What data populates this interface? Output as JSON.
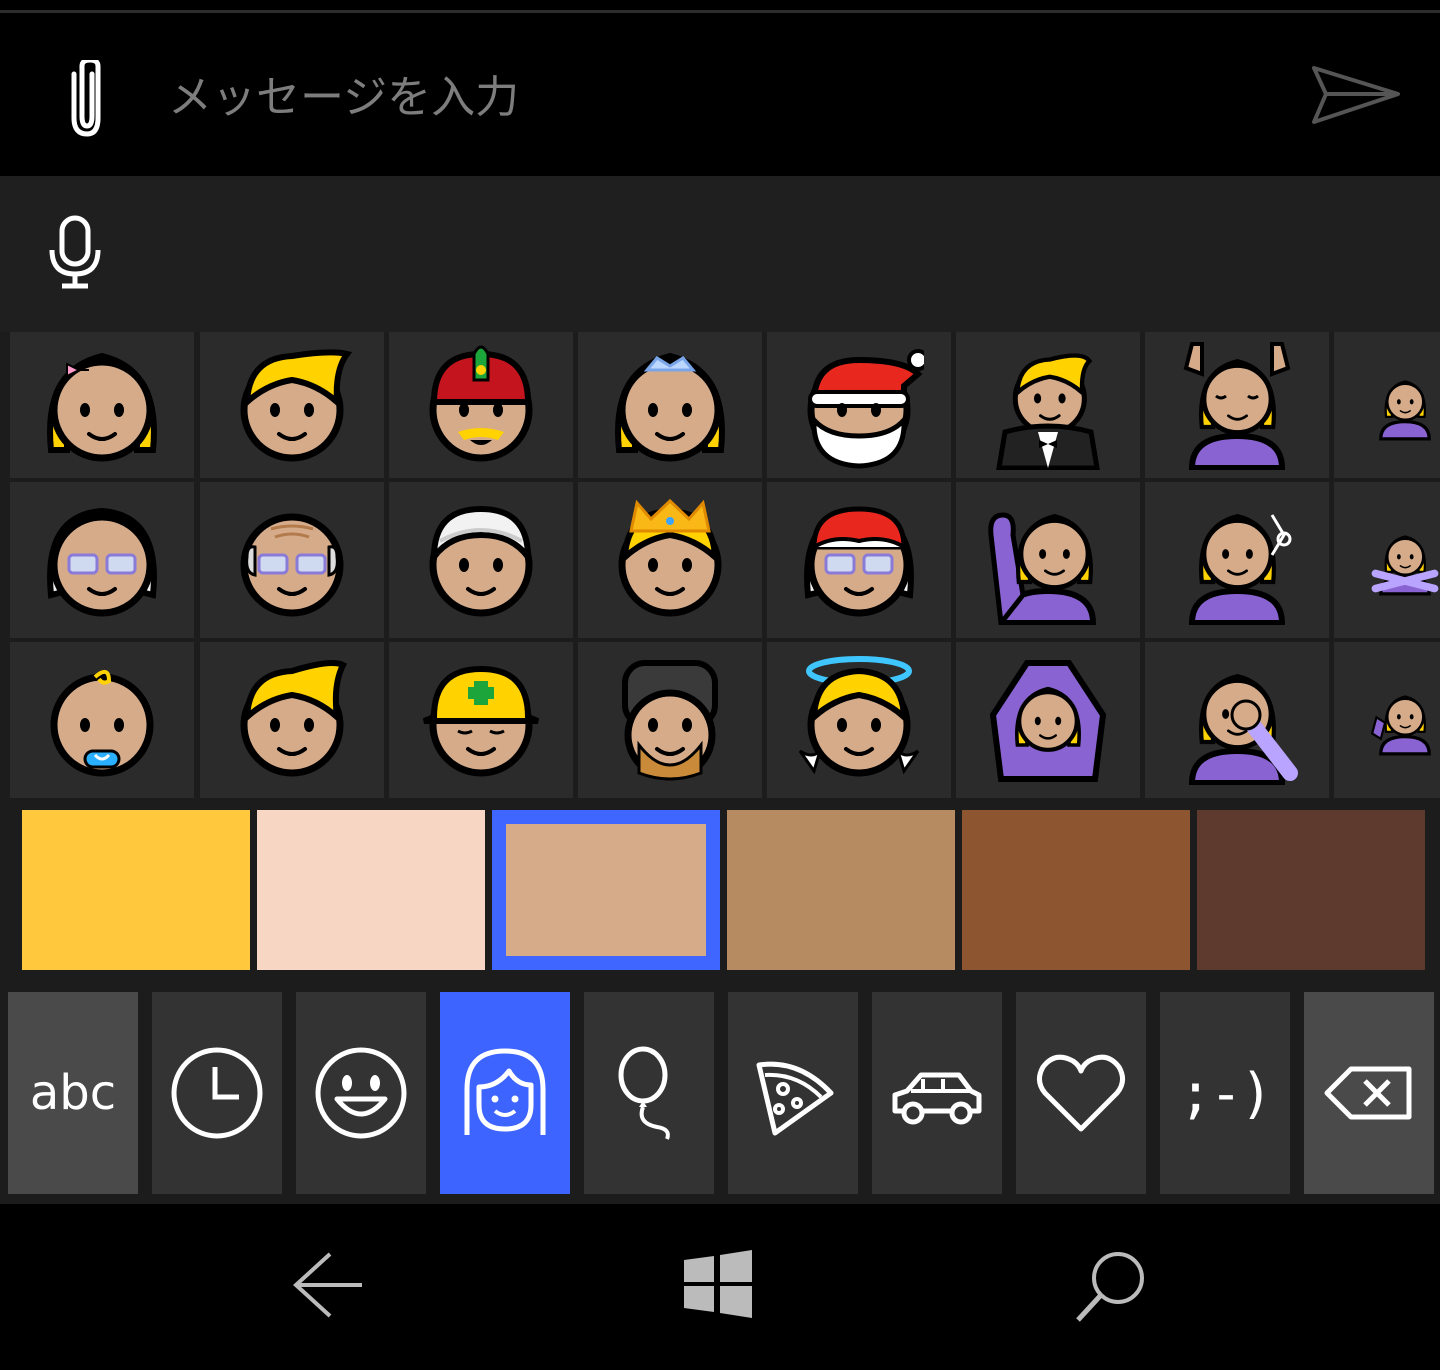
{
  "input": {
    "placeholder": "メッセージを入力",
    "value": ""
  },
  "icons": {
    "attach": "paperclip-icon",
    "send": "send-icon",
    "mic": "microphone-icon",
    "recent": "clock-icon",
    "smileys": "smiley-icon",
    "people": "person-icon",
    "celebration": "balloon-icon",
    "food": "pizza-icon",
    "travel": "car-icon",
    "symbols": "heart-icon",
    "backspace": "backspace-icon",
    "back": "back-arrow-icon",
    "start": "windows-logo-icon",
    "search": "search-icon"
  },
  "emoji_grid": [
    [
      "girl",
      "boy",
      "man-with-gua-pi-mao",
      "princess",
      "santa",
      "man-in-tuxedo",
      "woman-getting-massage",
      "person-with-folded-hands"
    ],
    [
      "older-woman",
      "older-man",
      "man-with-turban",
      "prince",
      "mrs-claus",
      "woman-raising-hand",
      "woman-getting-haircut",
      "woman-gesturing-no"
    ],
    [
      "baby",
      "man-blond",
      "rescue-worker",
      "guard",
      "baby-angel",
      "woman-gesturing-ok",
      "woman-facepalming",
      "woman-tipping-hand"
    ]
  ],
  "skin_tones": {
    "colors": [
      "#ffc83d",
      "#f7d7c4",
      "#d5ab8a",
      "#b78b62",
      "#8d5530",
      "#5e3a2e"
    ],
    "selected_index": 2
  },
  "categories": {
    "abc_label": "abc",
    "emoticon_label": ";-)",
    "selected": "people"
  },
  "colors": {
    "accent": "#3d64ff",
    "cell_bg": "#2b2b2b",
    "panel_bg": "#1f1f1f"
  }
}
